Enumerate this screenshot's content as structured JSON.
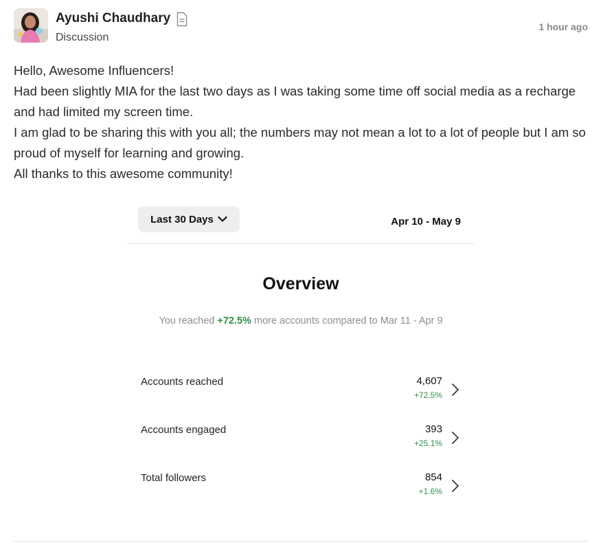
{
  "post": {
    "author_name": "Ayushi Chaudhary",
    "category": "Discussion",
    "time_ago": "1 hour ago",
    "body": [
      "Hello, Awesome Influencers!",
      "Had been slightly MIA for the last two days as I was taking some time off social media as a recharge and had limited my screen time.",
      "I am glad to be sharing this with you all; the numbers may not mean a lot to a lot of people but I am so proud of myself for learning and growing.",
      "All thanks to this awesome community!"
    ]
  },
  "insights": {
    "period_label": "Last 30 Days",
    "date_range": "Apr 10 - May 9",
    "overview_title": "Overview",
    "reach_note": {
      "prefix": "You reached ",
      "percent": "+72.5%",
      "suffix": " more accounts compared to Mar 11 - Apr 9"
    },
    "metrics": [
      {
        "label": "Accounts reached",
        "value": "4,607",
        "change": "+72.5%"
      },
      {
        "label": "Accounts engaged",
        "value": "393",
        "change": "+25.1%"
      },
      {
        "label": "Total followers",
        "value": "854",
        "change": "+1.6%"
      }
    ]
  },
  "colors": {
    "positive_green": "#2f8f46",
    "muted_text": "#8e8e8e",
    "button_bg": "#eeeeee"
  },
  "icons": {
    "header_type": "document-icon",
    "period_dropdown": "chevron-down-icon",
    "metric_arrow": "chevron-right-icon"
  }
}
